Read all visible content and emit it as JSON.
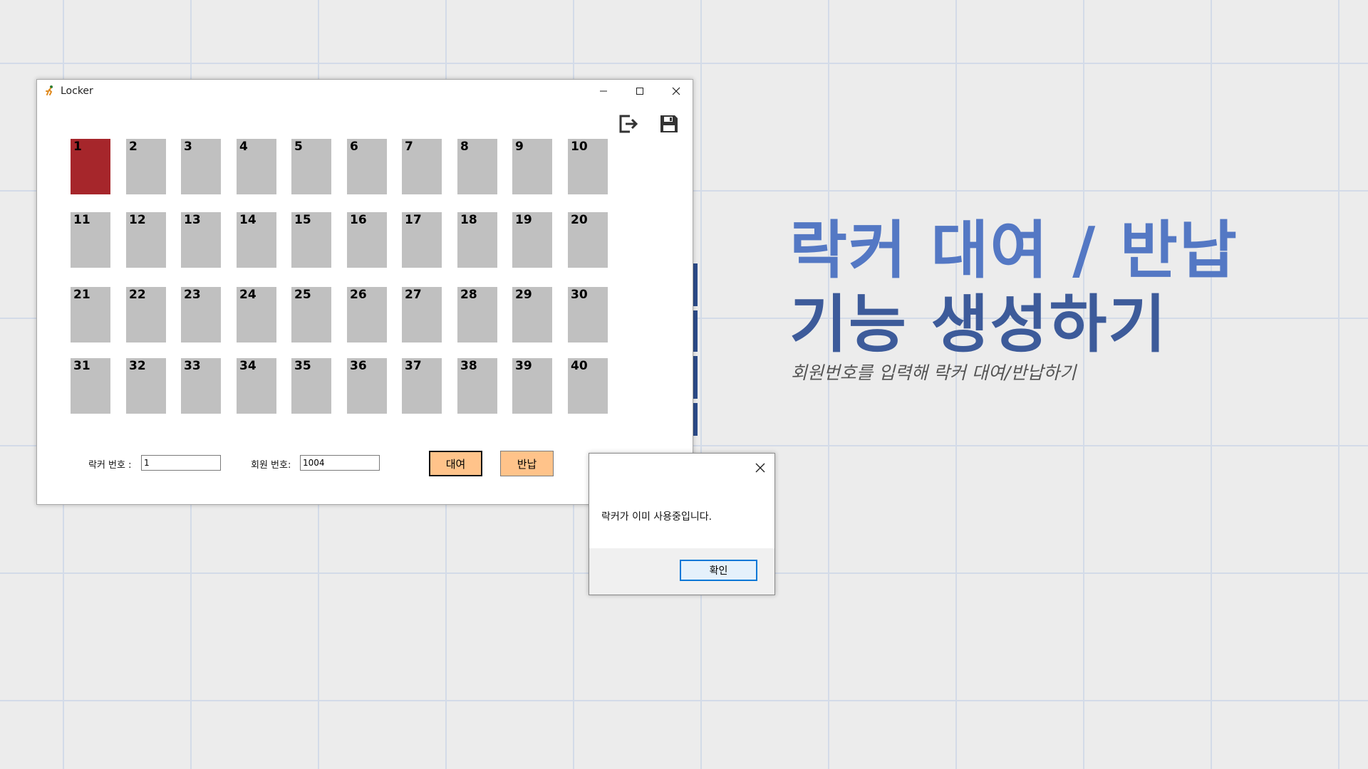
{
  "window": {
    "title": "Locker",
    "controls": {
      "minimize": "minimize-icon",
      "maximize": "maximize-icon",
      "close": "close-icon"
    },
    "toolbar": {
      "exit_icon": "exit-icon",
      "save_icon": "save-icon"
    }
  },
  "lockers": [
    {
      "number": "1",
      "occupied": true
    },
    {
      "number": "2",
      "occupied": false
    },
    {
      "number": "3",
      "occupied": false
    },
    {
      "number": "4",
      "occupied": false
    },
    {
      "number": "5",
      "occupied": false
    },
    {
      "number": "6",
      "occupied": false
    },
    {
      "number": "7",
      "occupied": false
    },
    {
      "number": "8",
      "occupied": false
    },
    {
      "number": "9",
      "occupied": false
    },
    {
      "number": "10",
      "occupied": false
    },
    {
      "number": "11",
      "occupied": false
    },
    {
      "number": "12",
      "occupied": false
    },
    {
      "number": "13",
      "occupied": false
    },
    {
      "number": "14",
      "occupied": false
    },
    {
      "number": "15",
      "occupied": false
    },
    {
      "number": "16",
      "occupied": false
    },
    {
      "number": "17",
      "occupied": false
    },
    {
      "number": "18",
      "occupied": false
    },
    {
      "number": "19",
      "occupied": false
    },
    {
      "number": "20",
      "occupied": false
    },
    {
      "number": "21",
      "occupied": false
    },
    {
      "number": "22",
      "occupied": false
    },
    {
      "number": "23",
      "occupied": false
    },
    {
      "number": "24",
      "occupied": false
    },
    {
      "number": "25",
      "occupied": false
    },
    {
      "number": "26",
      "occupied": false
    },
    {
      "number": "27",
      "occupied": false
    },
    {
      "number": "28",
      "occupied": false
    },
    {
      "number": "29",
      "occupied": false
    },
    {
      "number": "30",
      "occupied": false
    },
    {
      "number": "31",
      "occupied": false
    },
    {
      "number": "32",
      "occupied": false
    },
    {
      "number": "33",
      "occupied": false
    },
    {
      "number": "34",
      "occupied": false
    },
    {
      "number": "35",
      "occupied": false
    },
    {
      "number": "36",
      "occupied": false
    },
    {
      "number": "37",
      "occupied": false
    },
    {
      "number": "38",
      "occupied": false
    },
    {
      "number": "39",
      "occupied": false
    },
    {
      "number": "40",
      "occupied": false
    }
  ],
  "colors": {
    "occupied": "#a6262b",
    "available": "#c0c0c0",
    "button": "#ffc38a"
  },
  "form": {
    "locker_label": "락커 번호 :",
    "locker_value": "1",
    "member_label": "회원 번호:",
    "member_value": "1004",
    "rent_button": "대여",
    "return_button": "반납"
  },
  "dialog": {
    "message": "락커가 이미 사용중입니다.",
    "ok_button": "확인",
    "close_icon": "close-icon"
  },
  "headline": {
    "line1": "락커 대여 / 반납",
    "line2": "기능 생성하기",
    "subtitle": "회원번호를 입력해 락커 대여/반납하기"
  }
}
